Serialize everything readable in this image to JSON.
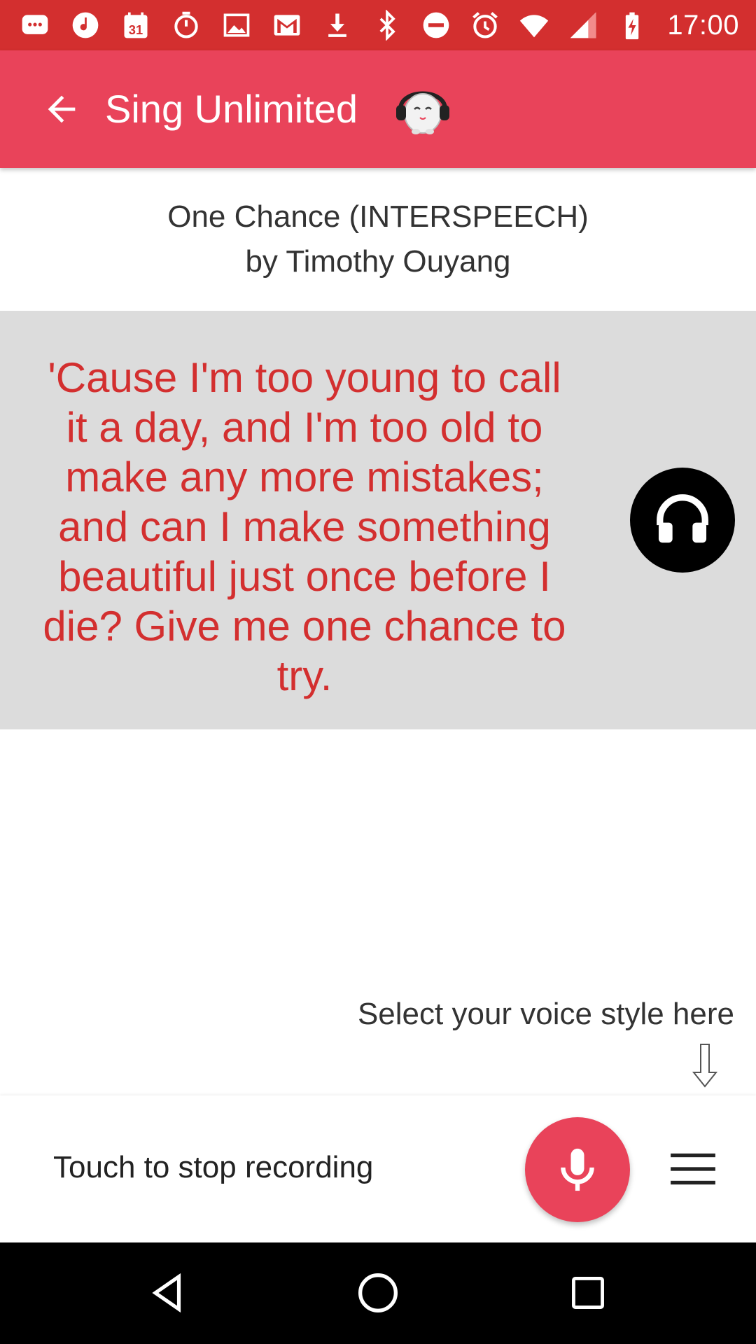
{
  "status_bar": {
    "time": "17:00",
    "left_icons": [
      "chat-icon",
      "music-icon",
      "calendar-icon",
      "stopwatch-icon",
      "image-icon",
      "gmail-icon",
      "download-icon"
    ],
    "calendar_day": "31",
    "right_icons": [
      "bluetooth-icon",
      "do-not-disturb-icon",
      "alarm-icon",
      "wifi-icon",
      "cell-signal-icon",
      "battery-charging-icon"
    ]
  },
  "app_bar": {
    "title": "Sing Unlimited"
  },
  "song": {
    "title": "One Chance (INTERSPEECH)",
    "artist_line": "by Timothy Ouyang"
  },
  "lyrics": {
    "text": "'Cause I'm too young to call it a day, and I'm too old to make any more mistakes; and can I make something beautiful just once before I die? Give me one chance to try."
  },
  "hint": {
    "text": "Select your voice style here"
  },
  "recording": {
    "status_text": "Touch to stop recording"
  },
  "colors": {
    "status_bar": "#d32f2f",
    "app_bar": "#e9435a",
    "lyrics_text": "#d32f2f",
    "lyrics_background": "#dcdcdc",
    "mic_button": "#e9435a"
  }
}
